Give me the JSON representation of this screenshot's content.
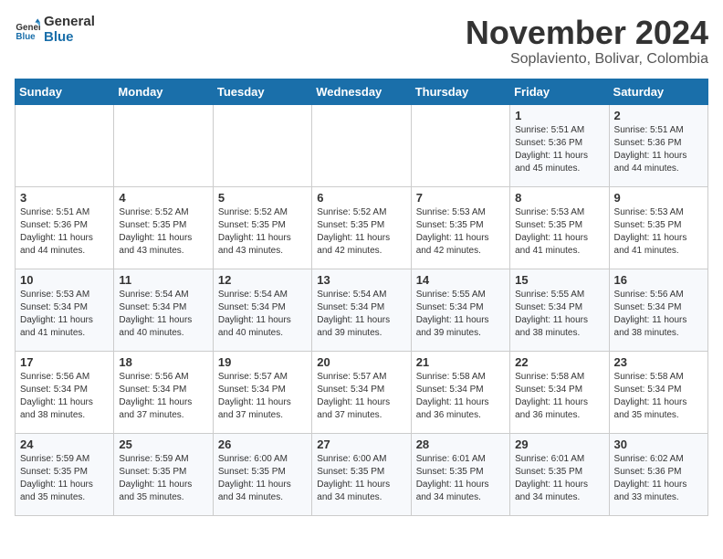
{
  "header": {
    "logo_line1": "General",
    "logo_line2": "Blue",
    "month_year": "November 2024",
    "location": "Soplaviento, Bolivar, Colombia"
  },
  "weekdays": [
    "Sunday",
    "Monday",
    "Tuesday",
    "Wednesday",
    "Thursday",
    "Friday",
    "Saturday"
  ],
  "weeks": [
    [
      {
        "day": "",
        "info": ""
      },
      {
        "day": "",
        "info": ""
      },
      {
        "day": "",
        "info": ""
      },
      {
        "day": "",
        "info": ""
      },
      {
        "day": "",
        "info": ""
      },
      {
        "day": "1",
        "info": "Sunrise: 5:51 AM\nSunset: 5:36 PM\nDaylight: 11 hours\nand 45 minutes."
      },
      {
        "day": "2",
        "info": "Sunrise: 5:51 AM\nSunset: 5:36 PM\nDaylight: 11 hours\nand 44 minutes."
      }
    ],
    [
      {
        "day": "3",
        "info": "Sunrise: 5:51 AM\nSunset: 5:36 PM\nDaylight: 11 hours\nand 44 minutes."
      },
      {
        "day": "4",
        "info": "Sunrise: 5:52 AM\nSunset: 5:35 PM\nDaylight: 11 hours\nand 43 minutes."
      },
      {
        "day": "5",
        "info": "Sunrise: 5:52 AM\nSunset: 5:35 PM\nDaylight: 11 hours\nand 43 minutes."
      },
      {
        "day": "6",
        "info": "Sunrise: 5:52 AM\nSunset: 5:35 PM\nDaylight: 11 hours\nand 42 minutes."
      },
      {
        "day": "7",
        "info": "Sunrise: 5:53 AM\nSunset: 5:35 PM\nDaylight: 11 hours\nand 42 minutes."
      },
      {
        "day": "8",
        "info": "Sunrise: 5:53 AM\nSunset: 5:35 PM\nDaylight: 11 hours\nand 41 minutes."
      },
      {
        "day": "9",
        "info": "Sunrise: 5:53 AM\nSunset: 5:35 PM\nDaylight: 11 hours\nand 41 minutes."
      }
    ],
    [
      {
        "day": "10",
        "info": "Sunrise: 5:53 AM\nSunset: 5:34 PM\nDaylight: 11 hours\nand 41 minutes."
      },
      {
        "day": "11",
        "info": "Sunrise: 5:54 AM\nSunset: 5:34 PM\nDaylight: 11 hours\nand 40 minutes."
      },
      {
        "day": "12",
        "info": "Sunrise: 5:54 AM\nSunset: 5:34 PM\nDaylight: 11 hours\nand 40 minutes."
      },
      {
        "day": "13",
        "info": "Sunrise: 5:54 AM\nSunset: 5:34 PM\nDaylight: 11 hours\nand 39 minutes."
      },
      {
        "day": "14",
        "info": "Sunrise: 5:55 AM\nSunset: 5:34 PM\nDaylight: 11 hours\nand 39 minutes."
      },
      {
        "day": "15",
        "info": "Sunrise: 5:55 AM\nSunset: 5:34 PM\nDaylight: 11 hours\nand 38 minutes."
      },
      {
        "day": "16",
        "info": "Sunrise: 5:56 AM\nSunset: 5:34 PM\nDaylight: 11 hours\nand 38 minutes."
      }
    ],
    [
      {
        "day": "17",
        "info": "Sunrise: 5:56 AM\nSunset: 5:34 PM\nDaylight: 11 hours\nand 38 minutes."
      },
      {
        "day": "18",
        "info": "Sunrise: 5:56 AM\nSunset: 5:34 PM\nDaylight: 11 hours\nand 37 minutes."
      },
      {
        "day": "19",
        "info": "Sunrise: 5:57 AM\nSunset: 5:34 PM\nDaylight: 11 hours\nand 37 minutes."
      },
      {
        "day": "20",
        "info": "Sunrise: 5:57 AM\nSunset: 5:34 PM\nDaylight: 11 hours\nand 37 minutes."
      },
      {
        "day": "21",
        "info": "Sunrise: 5:58 AM\nSunset: 5:34 PM\nDaylight: 11 hours\nand 36 minutes."
      },
      {
        "day": "22",
        "info": "Sunrise: 5:58 AM\nSunset: 5:34 PM\nDaylight: 11 hours\nand 36 minutes."
      },
      {
        "day": "23",
        "info": "Sunrise: 5:58 AM\nSunset: 5:34 PM\nDaylight: 11 hours\nand 35 minutes."
      }
    ],
    [
      {
        "day": "24",
        "info": "Sunrise: 5:59 AM\nSunset: 5:35 PM\nDaylight: 11 hours\nand 35 minutes."
      },
      {
        "day": "25",
        "info": "Sunrise: 5:59 AM\nSunset: 5:35 PM\nDaylight: 11 hours\nand 35 minutes."
      },
      {
        "day": "26",
        "info": "Sunrise: 6:00 AM\nSunset: 5:35 PM\nDaylight: 11 hours\nand 34 minutes."
      },
      {
        "day": "27",
        "info": "Sunrise: 6:00 AM\nSunset: 5:35 PM\nDaylight: 11 hours\nand 34 minutes."
      },
      {
        "day": "28",
        "info": "Sunrise: 6:01 AM\nSunset: 5:35 PM\nDaylight: 11 hours\nand 34 minutes."
      },
      {
        "day": "29",
        "info": "Sunrise: 6:01 AM\nSunset: 5:35 PM\nDaylight: 11 hours\nand 34 minutes."
      },
      {
        "day": "30",
        "info": "Sunrise: 6:02 AM\nSunset: 5:36 PM\nDaylight: 11 hours\nand 33 minutes."
      }
    ]
  ]
}
